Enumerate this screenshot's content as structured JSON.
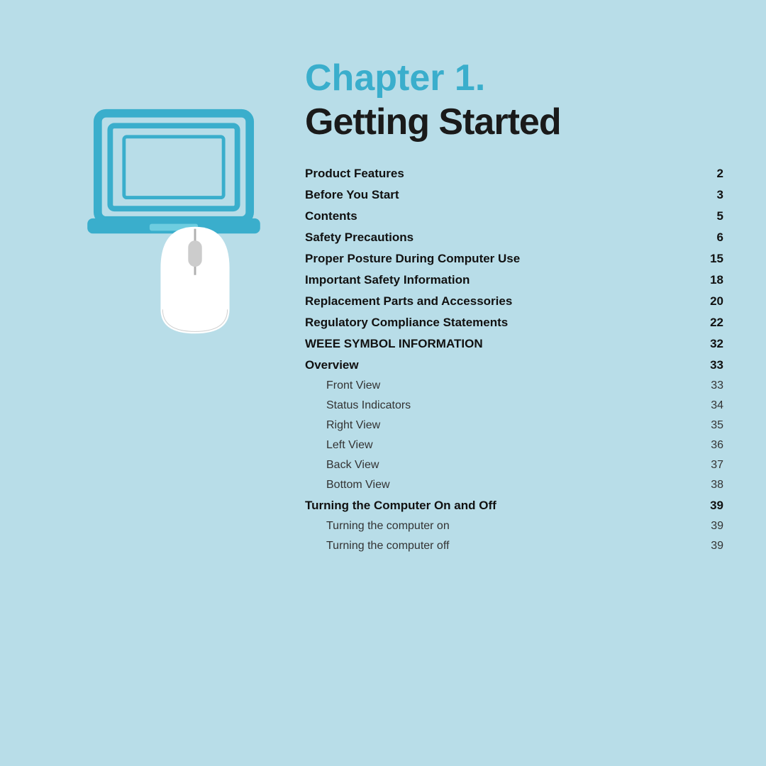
{
  "background_color": "#b8dde8",
  "chapter": {
    "label": "Chapter 1.",
    "title": "Getting Started"
  },
  "toc_items": [
    {
      "label": "Product Features",
      "page": "2",
      "level": "bold"
    },
    {
      "label": "Before You Start",
      "page": "3",
      "level": "bold"
    },
    {
      "label": "Contents",
      "page": "5",
      "level": "bold"
    },
    {
      "label": "Safety Precautions",
      "page": "6",
      "level": "bold"
    },
    {
      "label": "Proper Posture During Computer Use",
      "page": "15",
      "level": "bold"
    },
    {
      "label": "Important Safety Information",
      "page": "18",
      "level": "bold"
    },
    {
      "label": "Replacement Parts and Accessories",
      "page": "20",
      "level": "bold"
    },
    {
      "label": "Regulatory Compliance Statements",
      "page": "22",
      "level": "bold"
    },
    {
      "label": "WEEE SYMBOL INFORMATION",
      "page": "32",
      "level": "bold"
    },
    {
      "label": "Overview",
      "page": "33",
      "level": "bold"
    },
    {
      "label": "Front View",
      "page": "33",
      "level": "sub"
    },
    {
      "label": "Status Indicators",
      "page": "34",
      "level": "sub"
    },
    {
      "label": "Right View",
      "page": "35",
      "level": "sub"
    },
    {
      "label": "Left View",
      "page": "36",
      "level": "sub"
    },
    {
      "label": "Back View",
      "page": "37",
      "level": "sub"
    },
    {
      "label": "Bottom View",
      "page": "38",
      "level": "sub"
    },
    {
      "label": "Turning the Computer On and Off",
      "page": "39",
      "level": "bold"
    },
    {
      "label": "Turning the computer on",
      "page": "39",
      "level": "sub"
    },
    {
      "label": "Turning the computer off",
      "page": "39",
      "level": "sub"
    }
  ]
}
